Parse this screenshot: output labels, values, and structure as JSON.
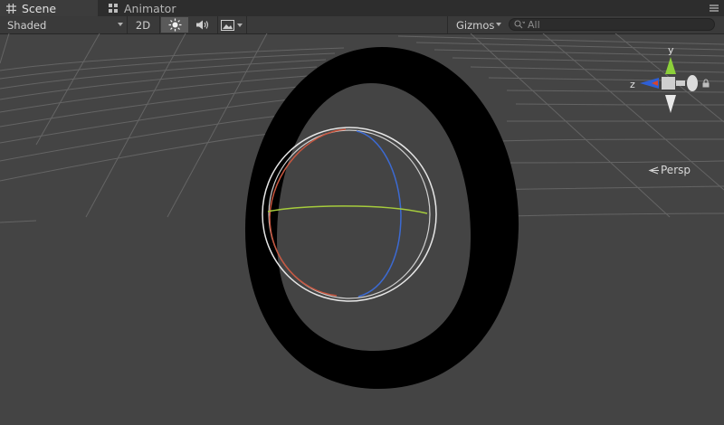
{
  "tabs": [
    {
      "label": "Scene",
      "icon": "scene-grid-icon",
      "active": true
    },
    {
      "label": "Animator",
      "icon": "animator-icon",
      "active": false
    }
  ],
  "toolbar": {
    "draw_mode": "Shaded",
    "mode_2d": "2D",
    "lighting_icon": "sun-icon",
    "audio_icon": "speaker-icon",
    "effects_icon": "image-icon",
    "gizmos": "Gizmos",
    "search_placeholder": "All",
    "search_icon": "search-icon"
  },
  "gizmo": {
    "x_label": "",
    "y_label": "y",
    "z_label": "z",
    "projection": "Persp",
    "colors": {
      "x": "#d6452f",
      "y": "#8cd03a",
      "z": "#2e5fd6"
    }
  },
  "scene": {
    "background": "#444444",
    "ring_color": "#000000",
    "sphere_gizmo_colors": {
      "outer": "#e0e0e0",
      "red": "#c0553c",
      "green": "#a6cc3c",
      "blue": "#3c6ad2"
    }
  }
}
